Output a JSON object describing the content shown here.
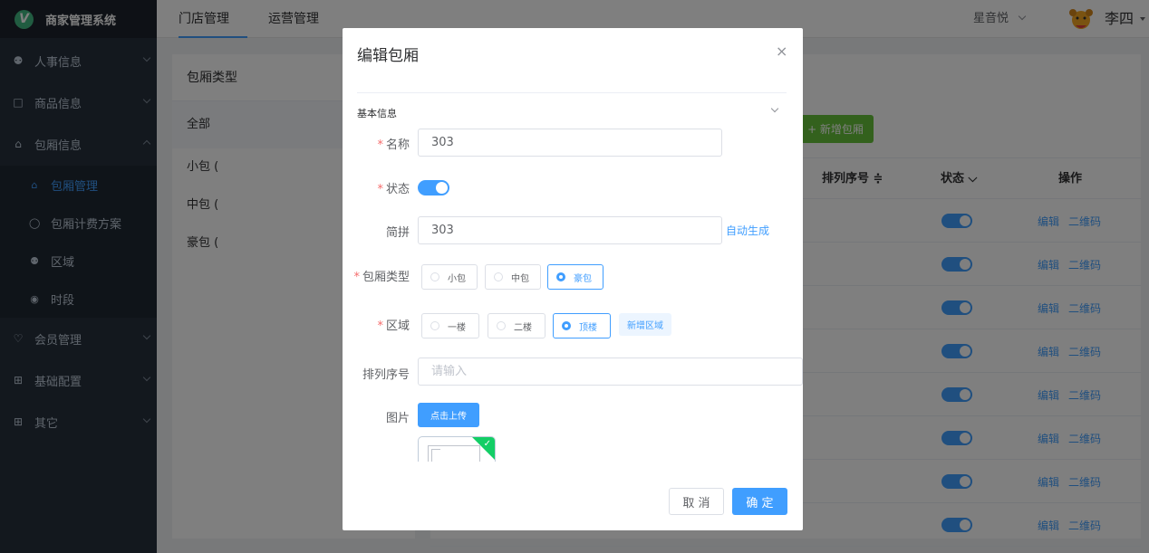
{
  "app": {
    "title": "商家管理系统",
    "logo_letter": "V"
  },
  "sidebar": {
    "menus": [
      {
        "label": "人事信息"
      },
      {
        "label": "商品信息"
      },
      {
        "label": "包厢信息"
      },
      {
        "label": "会员管理"
      },
      {
        "label": "基础配置"
      },
      {
        "label": "其它"
      }
    ],
    "sub_items": [
      {
        "label": "包厢管理"
      },
      {
        "label": "包厢计费方案"
      },
      {
        "label": "区域"
      },
      {
        "label": "时段"
      }
    ]
  },
  "header": {
    "tabs": [
      "门店管理",
      "运营管理"
    ],
    "store_name": "星音悦",
    "user_name": "李四"
  },
  "left_panel": {
    "title": "包厢类型",
    "items": [
      "全部",
      "小包 (",
      "中包 (",
      "豪包 ("
    ]
  },
  "table": {
    "add_button": "+ 新增包厢",
    "columns": {
      "sort": "排列序号 ≑",
      "status": "状态 ⌵",
      "actions": "操作"
    },
    "row_actions": {
      "edit": "编辑",
      "qrcode": "二维码"
    },
    "row_count": 8
  },
  "dialog": {
    "title": "编辑包厢",
    "section": "基本信息",
    "fields": {
      "name": {
        "label": "名称",
        "value": "303"
      },
      "status": {
        "label": "状态"
      },
      "pinyin": {
        "label": "简拼",
        "value": "303",
        "auto_label": "自动生成"
      },
      "room_type": {
        "label": "包厢类型",
        "options": [
          "小包",
          "中包",
          "豪包"
        ],
        "selected": "豪包"
      },
      "area": {
        "label": "区域",
        "options": [
          "一楼",
          "二楼",
          "顶楼"
        ],
        "selected": "顶楼",
        "add_label": "新增区域"
      },
      "sort": {
        "label": "排列序号",
        "placeholder": "请输入"
      },
      "image": {
        "label": "图片",
        "upload_label": "点击上传"
      }
    },
    "cancel": "取 消",
    "confirm": "确 定"
  },
  "colors": {
    "primary": "#409eff",
    "success": "#67c23a",
    "sidebar": "#26303d"
  }
}
